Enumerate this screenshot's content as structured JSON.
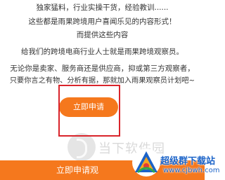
{
  "article": {
    "line1": "独家猛料，行业实操干货，经验教训......",
    "line2": "这些都是雨果跨境用户喜闻乐见的内容形式！",
    "line3": "而提供这些内容",
    "line4": "给我们的跨境电商行业人士就是雨果跨境观察员。",
    "line5": "无论你是卖家、服务商还是供应商，抑或第三方观察者，",
    "line6": "只要你言之有物、分析有据，那就加入雨果观察员计划吧~"
  },
  "cta": {
    "apply_label": "立即申请"
  },
  "bottom_bar": {
    "label": "立即申请观"
  },
  "watermark": {
    "site_name": "当下软件园"
  },
  "site_badge": {
    "title": "超级群下载站",
    "url": "www.cjbwh.com"
  },
  "colors": {
    "accent": "#f5781d",
    "highlight": "#d9242b",
    "badge_blue": "#1b63c8",
    "text": "#333333"
  }
}
